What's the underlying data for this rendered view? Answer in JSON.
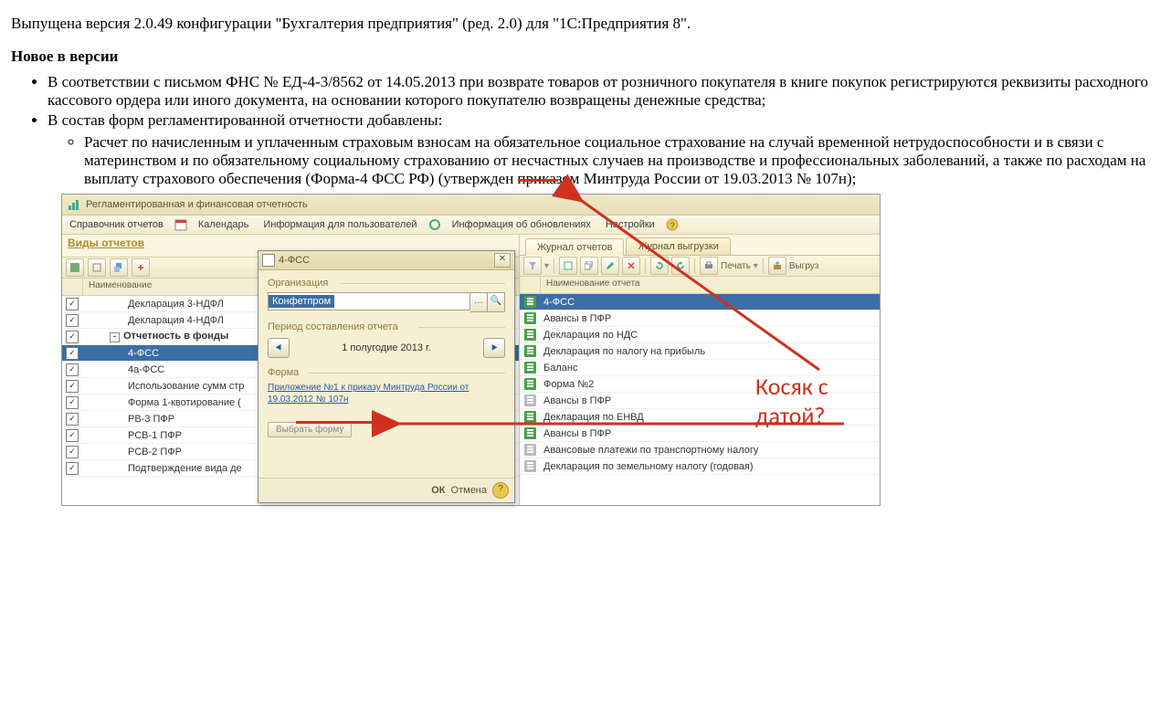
{
  "article": {
    "intro": "Выпущена версия 2.0.49 конфигурации \"Бухгалтерия предприятия\" (ред. 2.0) для \"1С:Предприятия 8\".",
    "heading": "Новое в версии",
    "bullet1": "В соответствии с письмом ФНС № ЕД-4-3/8562 от 14.05.2013 при возврате товаров от розничного покупателя в книге покупок регистрируются реквизиты расходного кассового ордера или иного документа, на основании которого покупателю возвращены денежные средства;",
    "bullet2": "В состав форм регламентированной отчетности добавлены:",
    "sub1": "Расчет по начисленным и уплаченным страховым взносам на обязательное социальное страхование на случай временной нетрудоспособности и в связи с материнством и по обязательному социальному страхованию от несчастных случаев на производстве и профессиональных заболеваний, а также по расходам на выплату страхового обеспечения (Форма-4 ФСС РФ) (утвержден приказом Минтруда России от 19.03.2013 № 107н);"
  },
  "window": {
    "title": "Регламентированная и финансовая отчетность",
    "menu": {
      "m1": "Справочник отчетов",
      "m2": "Календарь",
      "m3": "Информация для пользователей",
      "m4": "Информация об обновлениях",
      "m5": "Настройки"
    }
  },
  "left": {
    "heading": "Виды отчетов",
    "col": "Наименование",
    "rows": [
      {
        "label": "Декларация 3-НДФЛ",
        "indent": 2
      },
      {
        "label": "Декларация 4-НДФЛ",
        "indent": 2
      },
      {
        "label": "Отчетность в фонды",
        "indent": 1,
        "bold": true,
        "exp": "-"
      },
      {
        "label": "4-ФСС",
        "indent": 2,
        "sel": true
      },
      {
        "label": "4а-ФСС",
        "indent": 2
      },
      {
        "label": "Использование сумм стр",
        "indent": 2
      },
      {
        "label": "Форма 1-квотирование (",
        "indent": 2
      },
      {
        "label": "РВ-3 ПФР",
        "indent": 2
      },
      {
        "label": "РСВ-1 ПФР",
        "indent": 2
      },
      {
        "label": "РСВ-2 ПФР",
        "indent": 2
      },
      {
        "label": "Подтверждение вида де",
        "indent": 2
      }
    ]
  },
  "dialog": {
    "title": "4-ФСС",
    "grp_org": "Организация",
    "org_value": "Конфетпром",
    "grp_period": "Период составления отчета",
    "period_value": "1 полугодие 2013 г.",
    "grp_form": "Форма",
    "form_link": "Приложение №1 к приказу Минтруда России от 19.03.2012 № 107н",
    "select_form": "Выбрать форму",
    "ok": "ОК",
    "cancel": "Отмена"
  },
  "right": {
    "tab1": "Журнал отчетов",
    "tab2": "Журнал выгрузки",
    "print": "Печать",
    "export": "Выгруз",
    "col": "Наименование отчета",
    "rows": [
      {
        "label": "4-ФСС",
        "sel": true
      },
      {
        "label": "Авансы в ПФР"
      },
      {
        "label": "Декларация по НДС"
      },
      {
        "label": "Декларация по налогу на прибыль"
      },
      {
        "label": "Баланс"
      },
      {
        "label": "Форма №2"
      },
      {
        "label": "Авансы в ПФР",
        "alt": true
      },
      {
        "label": "Декларация по ЕНВД"
      },
      {
        "label": "Авансы в ПФР"
      },
      {
        "label": "Авансовые платежи по транспортному налогу",
        "alt": true
      },
      {
        "label": "Декларация по земельному налогу (годовая)",
        "alt": true
      }
    ]
  },
  "annotation": {
    "text": "Косяк с датой?"
  }
}
